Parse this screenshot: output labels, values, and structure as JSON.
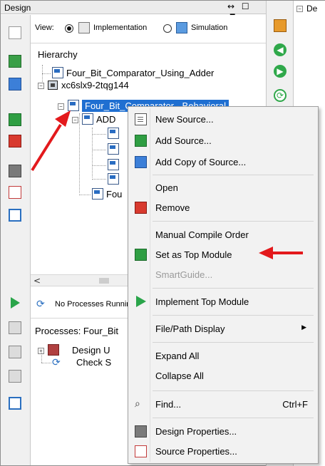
{
  "panel": {
    "title": "Design",
    "window_controls": "↔ ☐ 🗗 ✕"
  },
  "view": {
    "label": "View:",
    "implementation": "Implementation",
    "simulation": "Simulation",
    "selected": "Implementation"
  },
  "hierarchy": {
    "header": "Hierarchy",
    "project": "Four_Bit_Comparator_Using_Adder",
    "device": "xc6slx9-2tqg144",
    "top_module": "Four_Bit_Comparator - Behavioral",
    "child_1": "ADD",
    "child_2": "Fou"
  },
  "processes": {
    "status": "No Processes Running",
    "header": "Processes: Four_Bit",
    "item_1": "Design U",
    "item_2": "Check S"
  },
  "right_pane": {
    "title": "De"
  },
  "context_menu": {
    "items": [
      {
        "label": "New Source...",
        "icon": "new-source-icon"
      },
      {
        "label": "Add Source...",
        "icon": "add-source-icon"
      },
      {
        "label": "Add Copy of Source...",
        "icon": "add-copy-icon"
      },
      {
        "label": "Open",
        "icon": ""
      },
      {
        "label": "Remove",
        "icon": "remove-icon"
      },
      {
        "label": "Manual Compile Order",
        "icon": ""
      },
      {
        "label": "Set as Top Module",
        "icon": "top-module-icon"
      },
      {
        "label": "SmartGuide...",
        "icon": "",
        "disabled": true
      },
      {
        "label": "Implement Top Module",
        "icon": "play-icon"
      },
      {
        "label": "File/Path Display",
        "icon": "",
        "submenu": "▶"
      },
      {
        "label": "Expand All",
        "icon": ""
      },
      {
        "label": "Collapse All",
        "icon": ""
      },
      {
        "label": "Find...",
        "icon": "binoculars-icon",
        "shortcut": "Ctrl+F"
      },
      {
        "label": "Design Properties...",
        "icon": "design-properties-icon"
      },
      {
        "label": "Source Properties...",
        "icon": "source-properties-icon"
      }
    ]
  },
  "colors": {
    "selection": "#1f6fd1",
    "annotation_arrow": "#e3191c",
    "menu_background": "#f2f2f2"
  }
}
